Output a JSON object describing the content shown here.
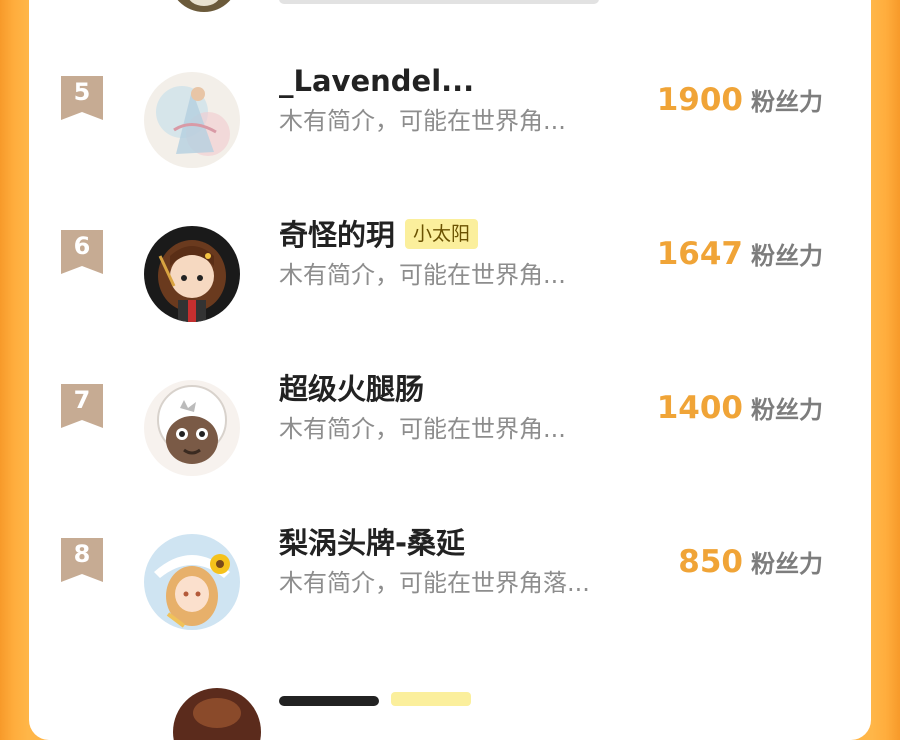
{
  "list": [
    {
      "rank": "5",
      "name": "_Lavendel...",
      "tag": "",
      "bio": "木有简介，可能在世界角...",
      "score": "1900",
      "unit": "粉丝力",
      "avatar_icon": "watercolor-lady-avatar"
    },
    {
      "rank": "6",
      "name": "奇怪的玥",
      "tag": "小太阳",
      "bio": "木有简介，可能在世界角...",
      "score": "1647",
      "unit": "粉丝力",
      "avatar_icon": "wizard-girl-avatar"
    },
    {
      "rank": "7",
      "name": "超级火腿肠",
      "tag": "",
      "bio": "木有简介，可能在世界角...",
      "score": "1400",
      "unit": "粉丝力",
      "avatar_icon": "sheep-avatar"
    },
    {
      "rank": "8",
      "name": "梨涡头牌-桑延",
      "tag": "",
      "bio": "木有简介，可能在世界角落...",
      "score": "850",
      "unit": "粉丝力",
      "avatar_icon": "sunflower-girl-avatar"
    }
  ],
  "colors": {
    "badge": "#c6ab93",
    "score": "#f0a437",
    "tag_bg": "#fbef9c",
    "frame": "#ffb648"
  }
}
